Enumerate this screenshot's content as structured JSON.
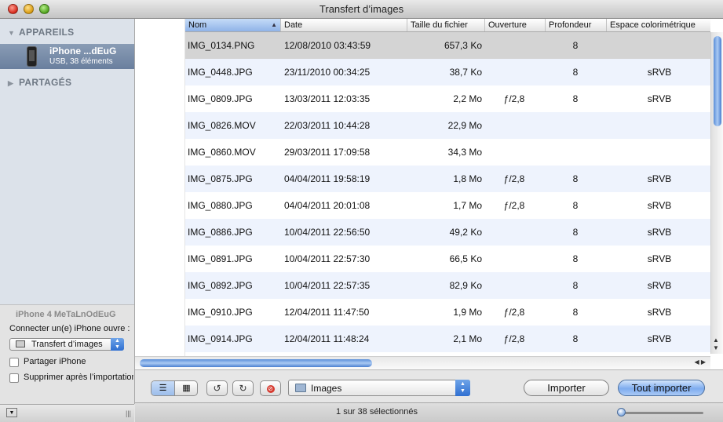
{
  "window": {
    "title": "Transfert d’images"
  },
  "sidebar": {
    "devices_header": "APPAREILS",
    "shared_header": "PARTAGÉS",
    "device": {
      "name": "iPhone ...dEuG",
      "subtitle": "USB, 38 éléments"
    },
    "device_panel": {
      "title": "iPhone 4 MeTaLnOdEuG",
      "connect_label": "Connecter un(e) iPhone ouvre :",
      "connect_app": "Transfert d’images",
      "share_label": "Partager iPhone",
      "share_checked": false,
      "delete_label": "Supprimer après l’importation",
      "delete_checked": false
    }
  },
  "table": {
    "columns": {
      "name": "Nom",
      "date": "Date",
      "size": "Taille du fichier",
      "aperture": "Ouverture",
      "depth": "Profondeur",
      "colorspace": "Espace colorimétrique"
    },
    "sort_column": "Nom",
    "rows": [
      {
        "name": "IMG_0134.PNG",
        "date": "12/08/2010 03:43:59",
        "size": "657,3 Ko",
        "aperture": "",
        "depth": "8",
        "colorspace": "",
        "selected": true
      },
      {
        "name": "IMG_0448.JPG",
        "date": "23/11/2010 00:34:25",
        "size": "38,7 Ko",
        "aperture": "",
        "depth": "8",
        "colorspace": "sRVB",
        "selected": false
      },
      {
        "name": "IMG_0809.JPG",
        "date": "13/03/2011 12:03:35",
        "size": "2,2 Mo",
        "aperture": "ƒ/2,8",
        "depth": "8",
        "colorspace": "sRVB",
        "selected": false
      },
      {
        "name": "IMG_0826.MOV",
        "date": "22/03/2011 10:44:28",
        "size": "22,9 Mo",
        "aperture": "",
        "depth": "",
        "colorspace": "",
        "selected": false
      },
      {
        "name": "IMG_0860.MOV",
        "date": "29/03/2011 17:09:58",
        "size": "34,3 Mo",
        "aperture": "",
        "depth": "",
        "colorspace": "",
        "selected": false
      },
      {
        "name": "IMG_0875.JPG",
        "date": "04/04/2011 19:58:19",
        "size": "1,8 Mo",
        "aperture": "ƒ/2,8",
        "depth": "8",
        "colorspace": "sRVB",
        "selected": false
      },
      {
        "name": "IMG_0880.JPG",
        "date": "04/04/2011 20:01:08",
        "size": "1,7 Mo",
        "aperture": "ƒ/2,8",
        "depth": "8",
        "colorspace": "sRVB",
        "selected": false
      },
      {
        "name": "IMG_0886.JPG",
        "date": "10/04/2011 22:56:50",
        "size": "49,2 Ko",
        "aperture": "",
        "depth": "8",
        "colorspace": "sRVB",
        "selected": false
      },
      {
        "name": "IMG_0891.JPG",
        "date": "10/04/2011 22:57:30",
        "size": "66,5 Ko",
        "aperture": "",
        "depth": "8",
        "colorspace": "sRVB",
        "selected": false
      },
      {
        "name": "IMG_0892.JPG",
        "date": "10/04/2011 22:57:35",
        "size": "82,9 Ko",
        "aperture": "",
        "depth": "8",
        "colorspace": "sRVB",
        "selected": false
      },
      {
        "name": "IMG_0910.JPG",
        "date": "12/04/2011 11:47:50",
        "size": "1,9 Mo",
        "aperture": "ƒ/2,8",
        "depth": "8",
        "colorspace": "sRVB",
        "selected": false
      },
      {
        "name": "IMG_0914.JPG",
        "date": "12/04/2011 11:48:24",
        "size": "2,1 Mo",
        "aperture": "ƒ/2,8",
        "depth": "8",
        "colorspace": "sRVB",
        "selected": false
      }
    ]
  },
  "toolbar": {
    "destination": "Images",
    "import_label": "Importer",
    "import_all_label": "Tout importer"
  },
  "status": {
    "text": "1 sur 38 sélectionnés"
  },
  "colors": {
    "selection_accent": "#6a7f9e",
    "alt_row": "#eef3fd",
    "selected_row": "#d4d4d4"
  }
}
